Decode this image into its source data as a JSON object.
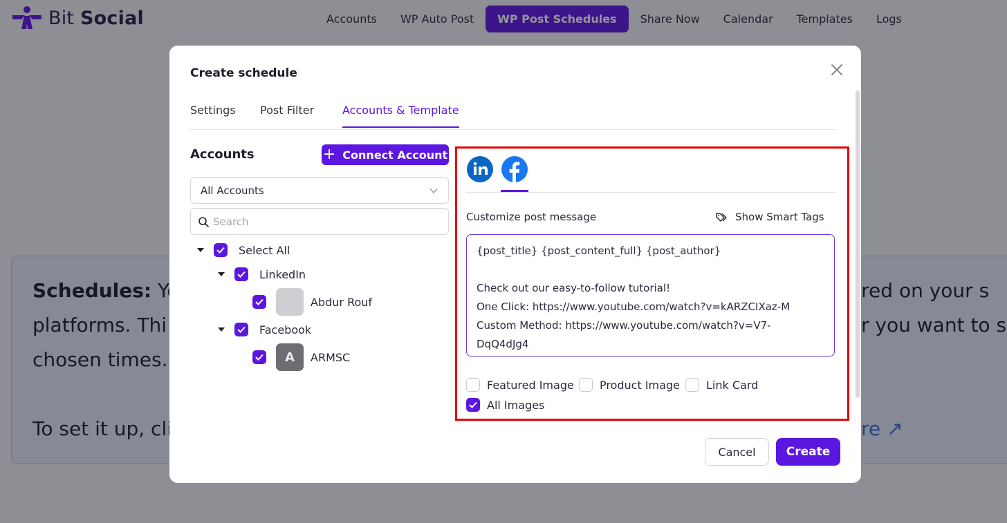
{
  "brand": {
    "name_light": "Bit",
    "name_bold": "Social",
    "color": "#5b17e0"
  },
  "nav": {
    "items": [
      {
        "label": "Accounts",
        "active": false
      },
      {
        "label": "WP Auto Post",
        "active": false
      },
      {
        "label": "WP Post Schedules",
        "active": true
      },
      {
        "label": "Share Now",
        "active": false
      },
      {
        "label": "Calendar",
        "active": false
      },
      {
        "label": "Templates",
        "active": false
      },
      {
        "label": "Logs",
        "active": false
      }
    ]
  },
  "background": {
    "line1_bold": "Schedules:",
    "line1_left": "Yo",
    "line1_right": "ared on your s",
    "line2_left": "platforms. Thi",
    "line2_right": "r you want to sh",
    "line3_left": "chosen times.",
    "line4_left": "To set it up, cli",
    "line4_right": "re ↗"
  },
  "modal": {
    "title": "Create schedule",
    "tabs": [
      {
        "label": "Settings",
        "active": false
      },
      {
        "label": "Post Filter",
        "active": false
      },
      {
        "label": "Accounts & Template",
        "active": true
      }
    ],
    "accounts": {
      "title": "Accounts",
      "connect_label": "Connect Account",
      "filter_value": "All Accounts",
      "search_placeholder": "Search",
      "select_all": "Select All",
      "groups": [
        {
          "name": "LinkedIn",
          "accounts": [
            {
              "name": "Abdur Rouf",
              "avatar": ""
            }
          ]
        },
        {
          "name": "Facebook",
          "accounts": [
            {
              "name": "ARMSC",
              "avatar": "A"
            }
          ]
        }
      ]
    },
    "template": {
      "platform_icons": [
        "linkedin-icon",
        "facebook-icon"
      ],
      "active_platform": "facebook",
      "customize_label": "Customize post message",
      "smart_tags_label": "Show Smart Tags",
      "message": "{post_title} {post_content_full} {post_author}\n\nCheck out our easy-to-follow tutorial!\nOne Click: https://www.youtube.com/watch?v=kARZCIXaz-M\nCustom Method: https://www.youtube.com/watch?v=V7-\nDqQ4dJg4",
      "options": [
        {
          "label": "Featured Image",
          "checked": false
        },
        {
          "label": "Product Image",
          "checked": false
        },
        {
          "label": "Link Card",
          "checked": false
        },
        {
          "label": "All Images",
          "checked": true
        }
      ]
    },
    "cancel_label": "Cancel",
    "create_label": "Create"
  }
}
